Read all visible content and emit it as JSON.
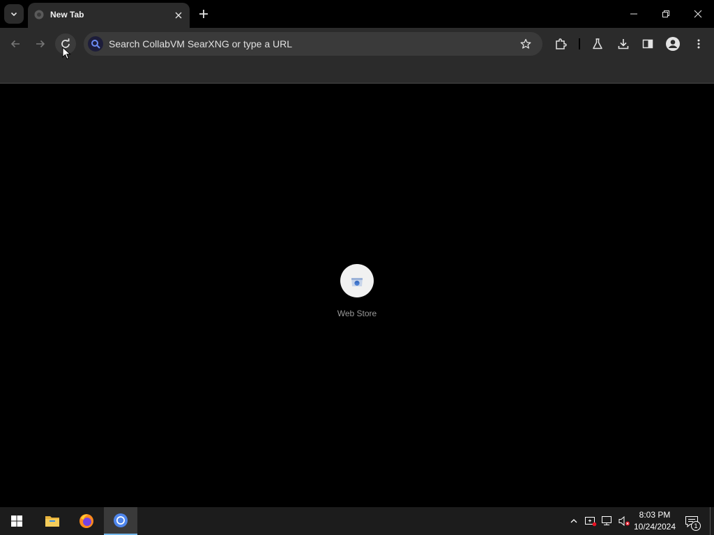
{
  "tabs": [
    {
      "title": "New Tab",
      "active": true,
      "icon": "globe-icon"
    }
  ],
  "window_controls": {
    "minimize_icon": "minimize-icon",
    "restore_icon": "restore-icon",
    "close_icon": "close-icon"
  },
  "toolbar": {
    "back_icon": "arrow-left-icon",
    "forward_icon": "arrow-right-icon",
    "reload_icon": "reload-icon",
    "omnibox": {
      "placeholder": "Search CollabVM SearXNG or type a URL",
      "value": "",
      "engine_icon": "search-icon"
    },
    "right_icons": [
      "extensions-icon",
      "labs-icon",
      "download-icon",
      "side-panel-icon",
      "profile-icon",
      "menu-icon"
    ]
  },
  "content": {
    "shortcuts": [
      {
        "label": "Web Store",
        "icon": "web-store-icon"
      }
    ]
  },
  "taskbar": {
    "apps": [
      "windows-start-icon",
      "file-explorer-icon",
      "firefox-icon",
      "chrome-icon"
    ],
    "active_app": "chrome-icon",
    "clock": {
      "time": "8:03 PM",
      "date": "10/24/2024"
    },
    "notification_count": "1"
  },
  "colors": {
    "tab_active": "#2b2b2b",
    "toolbar": "#2b2b2b",
    "omnibox": "#3a3a3a",
    "taskbar": "#1c1c1c",
    "taskbar_active_accent": "#76b9ed"
  }
}
